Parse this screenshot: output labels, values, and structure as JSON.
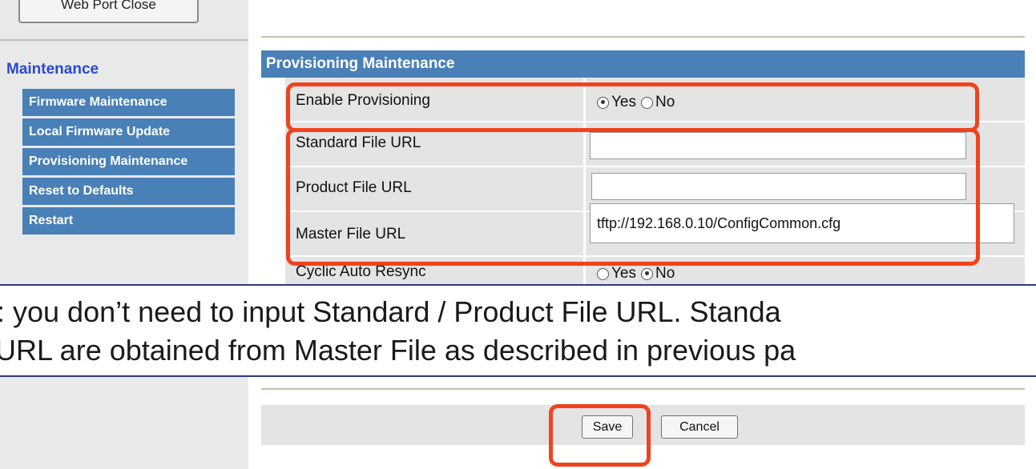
{
  "sidebar": {
    "top_button": "Web Port Close",
    "heading": "Maintenance",
    "items": [
      {
        "label": "Firmware Maintenance"
      },
      {
        "label": "Local Firmware Update"
      },
      {
        "label": "Provisioning Maintenance"
      },
      {
        "label": "Reset to Defaults"
      },
      {
        "label": "Restart"
      }
    ]
  },
  "panel": {
    "title": "Provisioning Maintenance",
    "enable_provisioning": {
      "label": "Enable Provisioning",
      "yes": "Yes",
      "no": "No",
      "selected": "Yes"
    },
    "standard_url": {
      "label": "Standard File URL",
      "value": ""
    },
    "product_url": {
      "label": "Product File URL",
      "value": ""
    },
    "master_url": {
      "label": "Master File URL",
      "value": "tftp://192.168.0.10/ConfigCommon.cfg"
    },
    "cyclic_resync": {
      "label": "Cyclic Auto Resync",
      "yes": "Yes",
      "no": "No",
      "selected": "No"
    }
  },
  "note": {
    "line1": "t: you don’t need to input Standard / Product File URL. Standa",
    "line2": "URL are obtained from Master File as described in previous pa"
  },
  "actions": {
    "save": "Save",
    "cancel": "Cancel"
  },
  "colors": {
    "accent": "#4a80b8",
    "highlight": "#f0421e",
    "heading": "#2a48d6"
  }
}
